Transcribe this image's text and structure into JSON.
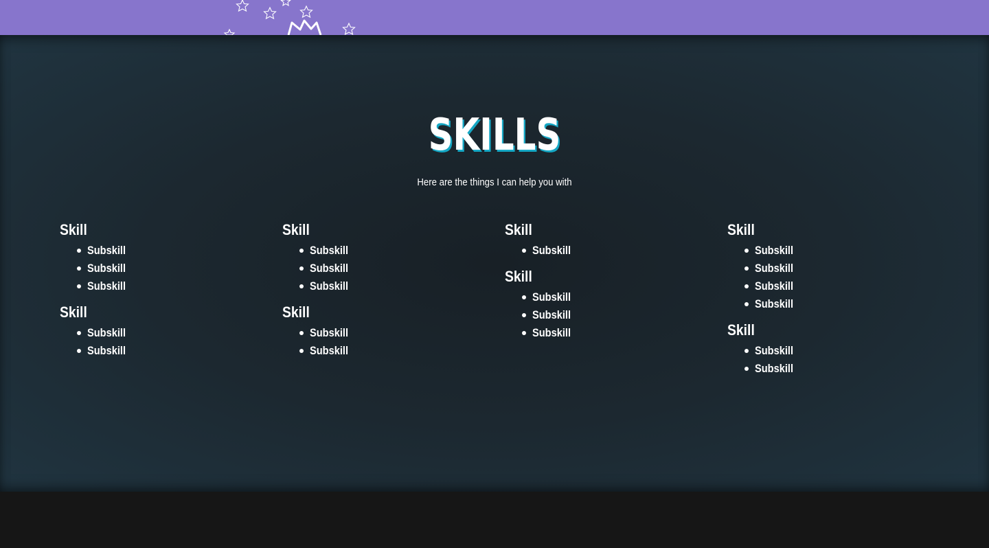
{
  "colors": {
    "banner": "#8775cc",
    "title_shadow": "#15a7c4",
    "footer": "#161616"
  },
  "header": {
    "decoration_icon": "stars-and-crown-icon"
  },
  "skills": {
    "title": "Skills",
    "subtitle": "Here are the things I can help you with",
    "columns": [
      {
        "groups": [
          {
            "title": "Skill",
            "items": [
              "Subskill",
              "Subskill",
              "Subskill"
            ]
          },
          {
            "title": "Skill",
            "items": [
              "Subskill",
              "Subskill"
            ]
          }
        ]
      },
      {
        "groups": [
          {
            "title": "Skill",
            "items": [
              "Subskill",
              "Subskill",
              "Subskill"
            ]
          },
          {
            "title": "Skill",
            "items": [
              "Subskill",
              "Subskill"
            ]
          }
        ]
      },
      {
        "groups": [
          {
            "title": "Skill",
            "items": [
              "Subskill"
            ]
          },
          {
            "title": "Skill",
            "items": [
              "Subskill",
              "Subskill",
              "Subskill"
            ]
          }
        ]
      },
      {
        "groups": [
          {
            "title": "Skill",
            "items": [
              "Subskill",
              "Subskill",
              "Subskill",
              "Subskill"
            ]
          },
          {
            "title": "Skill",
            "items": [
              "Subskill",
              "Subskill"
            ]
          }
        ]
      }
    ]
  }
}
